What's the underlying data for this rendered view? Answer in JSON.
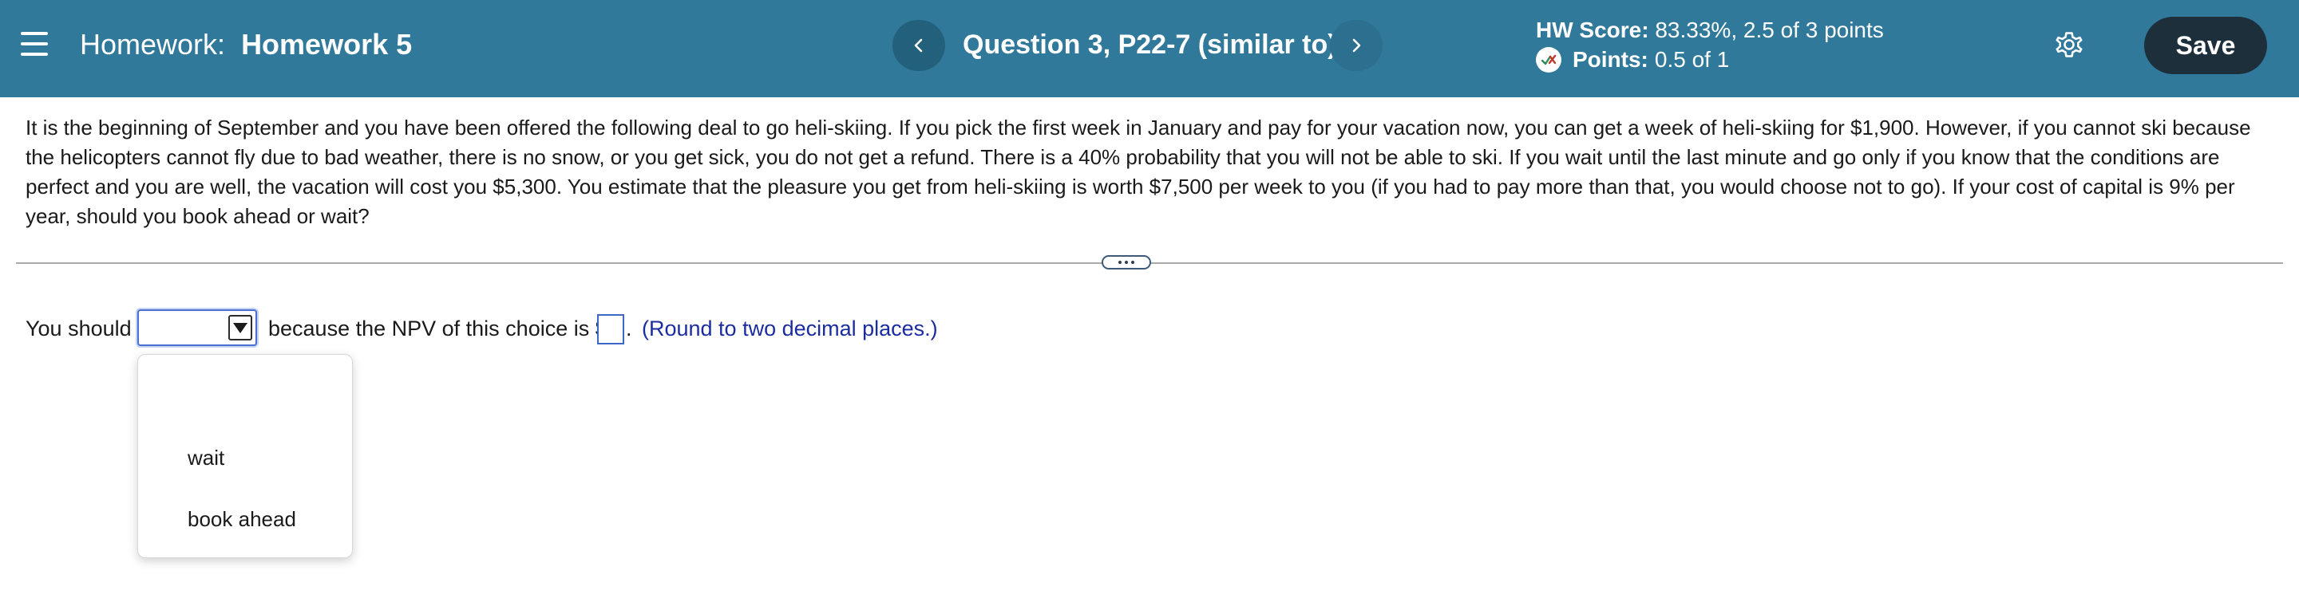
{
  "header": {
    "title_prefix": "Homework:",
    "title_name": "Homework 5",
    "question_title": "Question 3, P22-7 (similar to)",
    "score_label": "HW Score:",
    "score_value": "83.33%, 2.5 of 3 points",
    "points_label": "Points:",
    "points_value": "0.5 of 1",
    "save_label": "Save",
    "colors": {
      "bar": "#31799a",
      "save_button": "#1e2f3c"
    },
    "icons": [
      "menu-icon",
      "chevron-left-icon",
      "chevron-right-icon",
      "partial-credit-icon",
      "gear-icon"
    ]
  },
  "question": {
    "text": "It is the beginning of September and you have been offered the following deal to go heli-skiing. If you pick the first week in January and pay for your vacation now, you can get a week of heli-skiing for $1,900. However, if you cannot ski because the helicopters cannot fly due to bad weather, there is no snow, or you get sick, you do not get a refund. There is a 40% probability that you will not be able to ski. If you wait until the last minute and go only if you know that the conditions are perfect and you are well, the vacation will cost you $5,300. You estimate that the pleasure you get from heli-skiing is worth $7,500 per week to you (if you had to pay more than that, you would choose not to go). If your cost of capital is 9% per year, should you book ahead or wait?"
  },
  "answer": {
    "prefix": "You should",
    "middle": "because the NPV of this choice is $",
    "suffix": ".",
    "hint": "(Round to two decimal places.)",
    "selected_value": "",
    "npv_value": "",
    "dropdown_options": [
      "",
      "wait",
      "book ahead"
    ]
  }
}
